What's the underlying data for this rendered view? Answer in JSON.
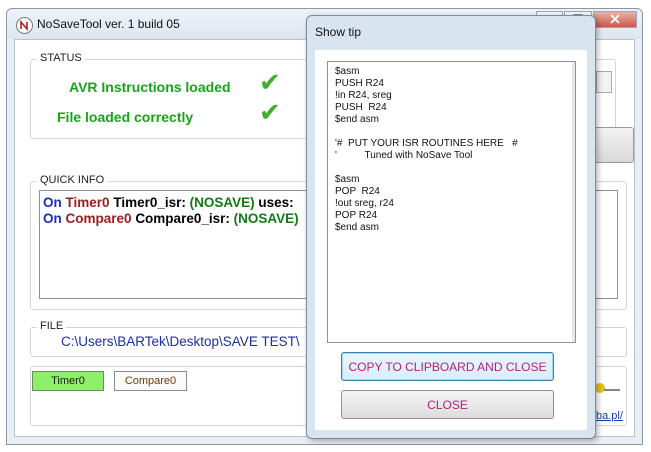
{
  "main_window": {
    "title": "NoSaveTool  ver. 1 build 05"
  },
  "status": {
    "label": "STATUS",
    "lines": [
      "AVR Instructions loaded",
      "File loaded correctly"
    ]
  },
  "quick_info": {
    "label": "QUICK INFO",
    "lines": [
      {
        "on": "On",
        "timer": "Timer0",
        "isr": "Timer0_isr:",
        "mode": "(NOSAVE)",
        "rest": "uses:"
      },
      {
        "on": "On",
        "timer": "Compare0",
        "isr": "Compare0_isr:",
        "mode": "(NOSAVE)",
        "rest": ""
      }
    ]
  },
  "file": {
    "label": "FILE",
    "path": "C:\\Users\\BARTek\\Desktop\\SAVE TEST\\"
  },
  "buttons": {
    "timer0": "Timer0",
    "compare0": "Compare0"
  },
  "footer_link": "ba.pl/",
  "tip": {
    "title": "Show tip",
    "code": "$asm\nPUSH R24\n!in R24, sreg\nPUSH  R24\n$end asm\n\n'#  PUT YOUR ISR ROUTINES HERE   #\n'          Tuned with NoSave Tool\n\n$asm\nPOP  R24\n!out sreg, r24\nPOP R24\n$end asm",
    "copy_button": "COPY TO CLIPBOARD AND CLOSE",
    "close_button": "CLOSE"
  },
  "colors": {
    "status_green": "#1aa31a",
    "keyword_blue": "#1530b5",
    "keyword_red": "#9b1c1c",
    "nosave_green": "#127a12",
    "button_text_magenta": "#b0227a",
    "timer_button_bg": "#8ef06a"
  },
  "icons": {
    "app": "nosave-app-icon",
    "status_ok": "checkmark-icon"
  }
}
